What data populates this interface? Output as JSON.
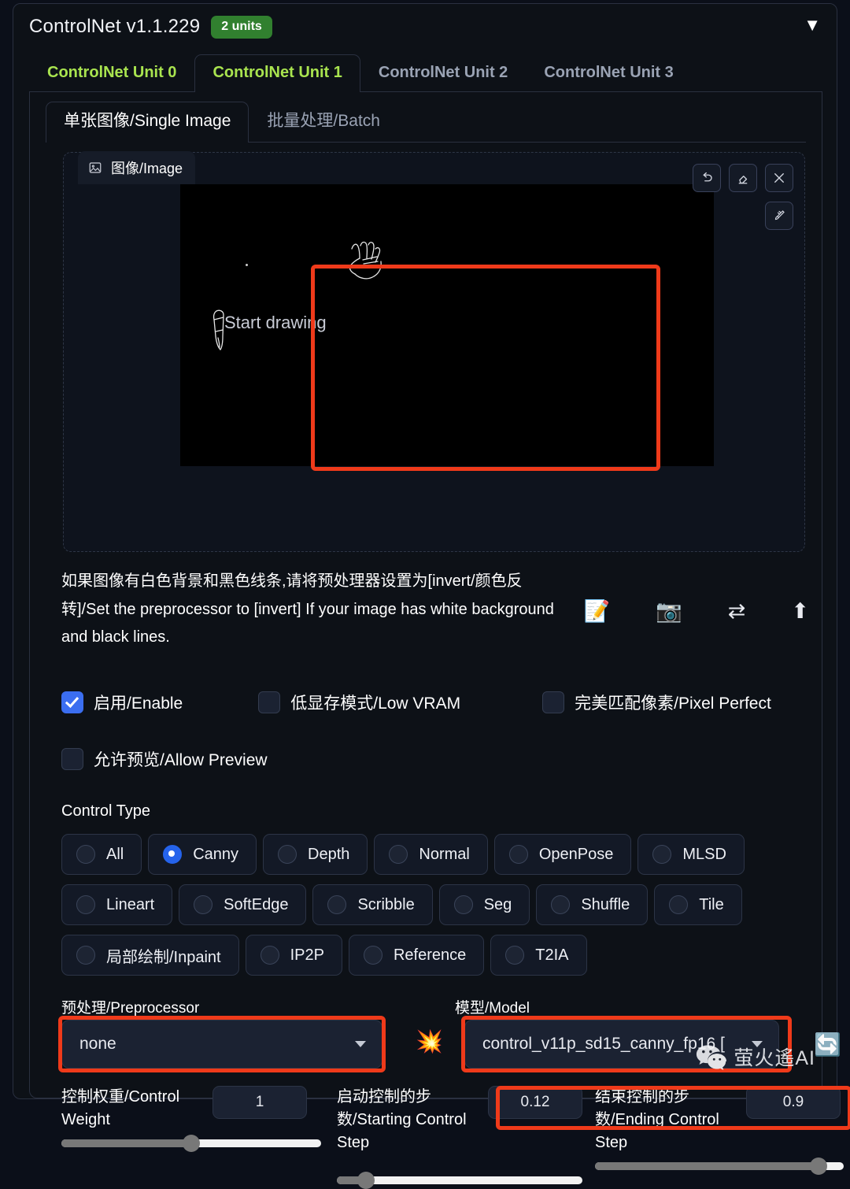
{
  "header": {
    "title": "ControlNet v1.1.229",
    "badge": "2 units",
    "caret": "▼"
  },
  "unit_tabs": [
    {
      "label": "ControlNet Unit 0",
      "active": false,
      "green": true
    },
    {
      "label": "ControlNet Unit 1",
      "active": true,
      "green": true
    },
    {
      "label": "ControlNet Unit 2",
      "active": false,
      "green": false
    },
    {
      "label": "ControlNet Unit 3",
      "active": false,
      "green": false
    }
  ],
  "source_tabs": [
    {
      "label": "单张图像/Single Image",
      "active": true
    },
    {
      "label": "批量处理/Batch",
      "active": false
    }
  ],
  "image_panel": {
    "tab_label": "图像/Image",
    "canvas_hint": "Start drawing",
    "tools": {
      "undo": "undo-icon",
      "erase": "eraser-icon",
      "close": "close-icon",
      "brush": "brush-icon"
    }
  },
  "hint": {
    "text": "如果图像有白色背景和黑色线条,请将预处理器设置为[invert/颜色反转]/Set the preprocessor to [invert] If your image has white background and black lines.",
    "icons": [
      {
        "glyph": "📝",
        "name": "edit-icon"
      },
      {
        "glyph": "📷",
        "name": "camera-icon"
      },
      {
        "glyph": "⇄",
        "name": "swap-icon"
      },
      {
        "glyph": "⬆",
        "name": "upload-icon"
      }
    ]
  },
  "checkboxes": [
    {
      "label": "启用/Enable",
      "checked": true
    },
    {
      "label": "低显存模式/Low VRAM",
      "checked": false
    },
    {
      "label": "完美匹配像素/Pixel Perfect",
      "checked": false
    },
    {
      "label": "允许预览/Allow Preview",
      "checked": false
    }
  ],
  "control_type": {
    "label": "Control Type",
    "options": [
      {
        "label": "All",
        "selected": false
      },
      {
        "label": "Canny",
        "selected": true
      },
      {
        "label": "Depth",
        "selected": false
      },
      {
        "label": "Normal",
        "selected": false
      },
      {
        "label": "OpenPose",
        "selected": false
      },
      {
        "label": "MLSD",
        "selected": false
      },
      {
        "label": "Lineart",
        "selected": false
      },
      {
        "label": "SoftEdge",
        "selected": false
      },
      {
        "label": "Scribble",
        "selected": false
      },
      {
        "label": "Seg",
        "selected": false
      },
      {
        "label": "Shuffle",
        "selected": false
      },
      {
        "label": "Tile",
        "selected": false
      },
      {
        "label": "局部绘制/Inpaint",
        "selected": false
      },
      {
        "label": "IP2P",
        "selected": false
      },
      {
        "label": "Reference",
        "selected": false
      },
      {
        "label": "T2IA",
        "selected": false
      }
    ]
  },
  "preprocessor": {
    "label": "预处理/Preprocessor",
    "value": "none"
  },
  "model": {
    "label": "模型/Model",
    "value": "control_v11p_sd15_canny_fp16 [",
    "refresh_icon": "🔄",
    "boom_icon": "💥"
  },
  "sliders": [
    {
      "name": "控制权重/Control Weight",
      "value": "1",
      "percent": 50
    },
    {
      "name": "启动控制的步数/Starting Control Step",
      "value": "0.12",
      "percent": 12
    },
    {
      "name": "结束控制的步数/Ending Control Step",
      "value": "0.9",
      "percent": 90
    }
  ],
  "watermark": {
    "text": "萤火遙AI"
  },
  "colors": {
    "accent_green": "#a9e44f",
    "badge_green": "#31802f",
    "annotation_red": "#ef3a1a",
    "checkbox_blue": "#3b6ef0",
    "radio_blue": "#2563eb",
    "panel_bg": "#0d1117",
    "page_bg": "#0b0f19"
  }
}
